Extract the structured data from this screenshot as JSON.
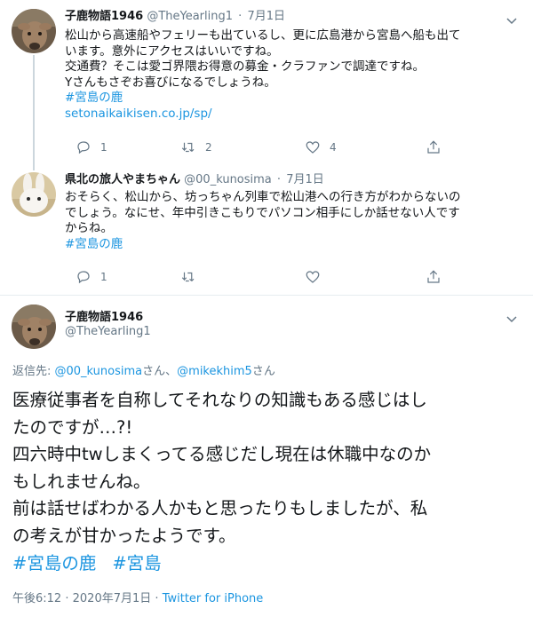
{
  "tweets": [
    {
      "name": "子鹿物語1946",
      "handle": "@TheYearling1",
      "date": "7月1日",
      "lines": [
        "松山から高速船やフェリーも出ているし、更に広島港から宮島へ船も出て",
        "います。意外にアクセスはいいですね。",
        "交通費？そこは愛ゴ界隈お得意の募金・クラファンで調達ですね。",
        "Yさんもさぞお喜びになるでしょうね。"
      ],
      "hashtag": "#宮島の鹿",
      "url": "setonaikaikisen.co.jp/sp/",
      "replies": "1",
      "retweets": "2",
      "likes": "4"
    },
    {
      "name": "県北の旅人やまちゃん",
      "handle": "@00_kunosima",
      "date": "7月1日",
      "lines": [
        "おそらく、松山から、坊っちゃん列車で松山港への行き方がわからないの",
        "でしょう。なにせ、年中引きこもりでパソコン相手にしか話せない人です",
        "からね。"
      ],
      "hashtag": "#宮島の鹿",
      "replies": "1",
      "retweets": "",
      "likes": ""
    }
  ],
  "main": {
    "name": "子鹿物語1946",
    "handle": "@TheYearling1",
    "reply_prefix": "返信先: ",
    "reply_user1": "@00_kunosima",
    "reply_mid": "さん、",
    "reply_user2": "@mikekhim5",
    "reply_suffix": "さん",
    "lines": [
      "医療従事者を自称してそれなりの知識もある感じはし",
      "たのですが…?!",
      "四六時中twしまくってる感じだし現在は休職中なのか",
      "もしれませんね。",
      "前は話せばわかる人かもと思ったりもしましたが、私",
      "の考えが甘かったようです。"
    ],
    "tags": [
      "#宮島の鹿",
      "#宮島"
    ],
    "time": "午後6:12",
    "dot": "·",
    "date": "2020年7月1日",
    "dot2": "·",
    "source": "Twitter for iPhone"
  },
  "colors": {
    "link": "#1b95e0",
    "muted": "#657786",
    "divider": "#e6ecf0",
    "thread": "#ccd6dd"
  },
  "icons": [
    "chevron-down-icon",
    "reply-icon",
    "retweet-icon",
    "like-icon",
    "share-icon"
  ]
}
